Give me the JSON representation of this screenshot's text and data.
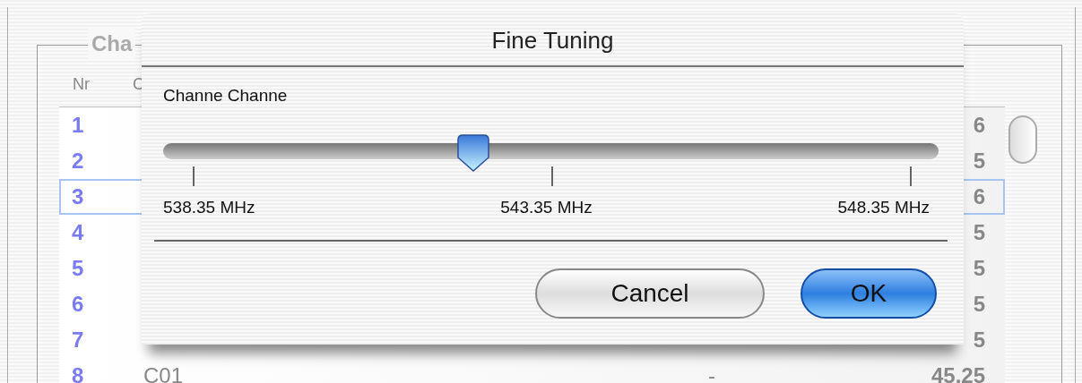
{
  "background_window": {
    "group_title": "Cha",
    "columns": [
      "Nr",
      "C"
    ],
    "rows": [
      {
        "nr": "1",
        "value": "6",
        "selected": false
      },
      {
        "nr": "2",
        "value": "5",
        "selected": false
      },
      {
        "nr": "3",
        "value": "6",
        "selected": true
      },
      {
        "nr": "4",
        "value": "5",
        "selected": false
      },
      {
        "nr": "5",
        "value": "5",
        "selected": false
      },
      {
        "nr": "6",
        "value": "5",
        "selected": false
      },
      {
        "nr": "7",
        "value": "5",
        "selected": false
      },
      {
        "nr": "8",
        "code": "C01",
        "mark": "-",
        "value": "45.25",
        "selected": false
      }
    ]
  },
  "dialog": {
    "title": "Fine Tuning",
    "label": "Channe Channe",
    "slider": {
      "level": 0.4,
      "ticks": [
        "538.35 MHz",
        "543.35 MHz",
        "548.35 MHz"
      ]
    },
    "buttons": [
      {
        "label": "Cancel",
        "default": false
      },
      {
        "label": "OK",
        "default": true
      }
    ]
  }
}
